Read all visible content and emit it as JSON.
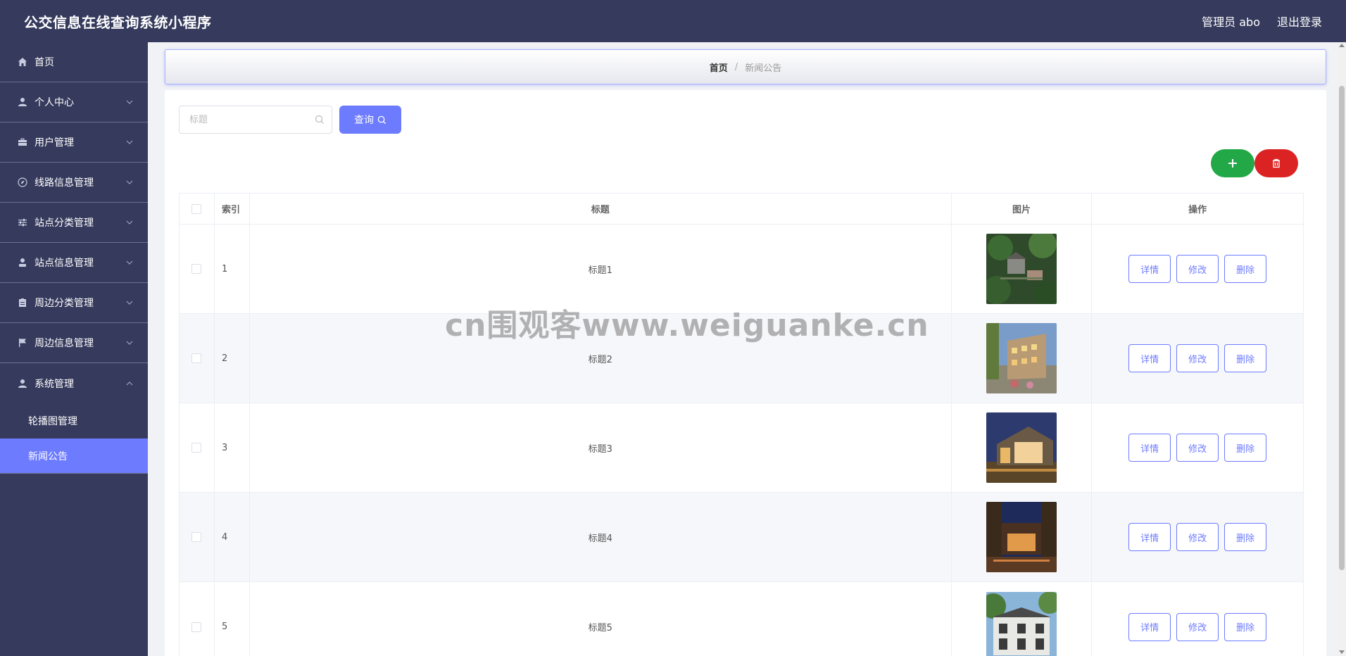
{
  "header": {
    "title": "公交信息在线查询系统小程序",
    "user": "管理员 abo",
    "logout": "退出登录"
  },
  "sidebar": {
    "items": [
      {
        "label": "首页",
        "icon": "home-icon"
      },
      {
        "label": "个人中心",
        "icon": "user-icon"
      },
      {
        "label": "用户管理",
        "icon": "briefcase-icon"
      },
      {
        "label": "线路信息管理",
        "icon": "compass-icon"
      },
      {
        "label": "站点分类管理",
        "icon": "sliders-icon"
      },
      {
        "label": "站点信息管理",
        "icon": "person-icon"
      },
      {
        "label": "周边分类管理",
        "icon": "clipboard-icon"
      },
      {
        "label": "周边信息管理",
        "icon": "flag-icon"
      },
      {
        "label": "系统管理",
        "icon": "user-icon"
      }
    ],
    "subitems": [
      {
        "label": "轮播图管理",
        "active": false
      },
      {
        "label": "新闻公告",
        "active": true
      }
    ]
  },
  "breadcrumb": {
    "home": "首页",
    "sep": "/",
    "current": "新闻公告"
  },
  "search": {
    "placeholder": "标题",
    "button": "查询"
  },
  "table": {
    "headers": {
      "index": "索引",
      "title": "标题",
      "image": "图片",
      "ops": "操作"
    },
    "rows": [
      {
        "index": "1",
        "title": "标题1"
      },
      {
        "index": "2",
        "title": "标题2"
      },
      {
        "index": "3",
        "title": "标题3"
      },
      {
        "index": "4",
        "title": "标题4"
      },
      {
        "index": "5",
        "title": "标题5"
      }
    ],
    "actions": {
      "detail": "详情",
      "edit": "修改",
      "delete": "删除"
    }
  },
  "watermark": "cn围观客www.weiguanke.cn",
  "colors": {
    "sidebar": "#363b5d",
    "accent": "#6d7bff",
    "add": "#22a846",
    "delete": "#dc2323"
  }
}
